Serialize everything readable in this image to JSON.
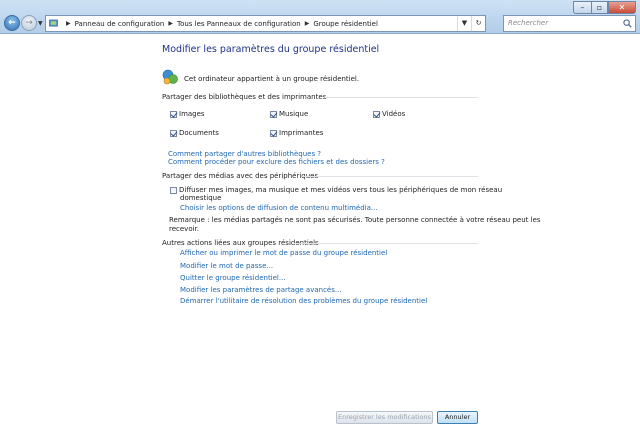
{
  "titlebar": {
    "breadcrumbs": [
      "Panneau de configuration",
      "Tous les Panneaux de configuration",
      "Groupe résidentiel"
    ],
    "search_placeholder": "Rechercher"
  },
  "page": {
    "heading": "Modifier les paramètres du groupe résidentiel",
    "owns_text": "Cet ordinateur appartient à un groupe résidentiel."
  },
  "libraries": {
    "title": "Partager des bibliothèques et des imprimantes",
    "items": [
      {
        "label": "Images",
        "checked": true
      },
      {
        "label": "Musique",
        "checked": true
      },
      {
        "label": "Vidéos",
        "checked": true
      },
      {
        "label": "Documents",
        "checked": true
      },
      {
        "label": "Imprimantes",
        "checked": true
      }
    ],
    "link_other": "Comment partager d'autres bibliothèques ?",
    "link_exclude": "Comment procéder pour exclure des fichiers et des dossiers ?"
  },
  "media": {
    "title": "Partager des médias avec des périphériques",
    "stream_label_line1": "Diffuser mes images, ma musique et mes vidéos vers tous les périphériques de mon réseau",
    "stream_label_line2": "domestique",
    "stream_checked": false,
    "link_options": "Choisir les options de diffusion de contenu multimédia...",
    "note_line1": "Remarque : les médias partagés ne sont pas sécurisés. Toute personne connectée à votre réseau peut les",
    "note_line2": "recevoir."
  },
  "actions": {
    "title": "Autres actions liées aux groupes résidentiels",
    "links": [
      "Afficher ou imprimer le mot de passe du groupe résidentiel",
      "Modifier le mot de passe...",
      "Quitter le groupe résidentiel...",
      "Modifier les paramètres de partage avancés...",
      "Démarrer l'utilitaire de résolution des problèmes du groupe résidentiel"
    ]
  },
  "footer": {
    "save_label": "Enregistrer les modifications",
    "cancel_label": "Annuler"
  },
  "colors": {
    "heading": "#1e3287",
    "link": "#1f67b2"
  }
}
